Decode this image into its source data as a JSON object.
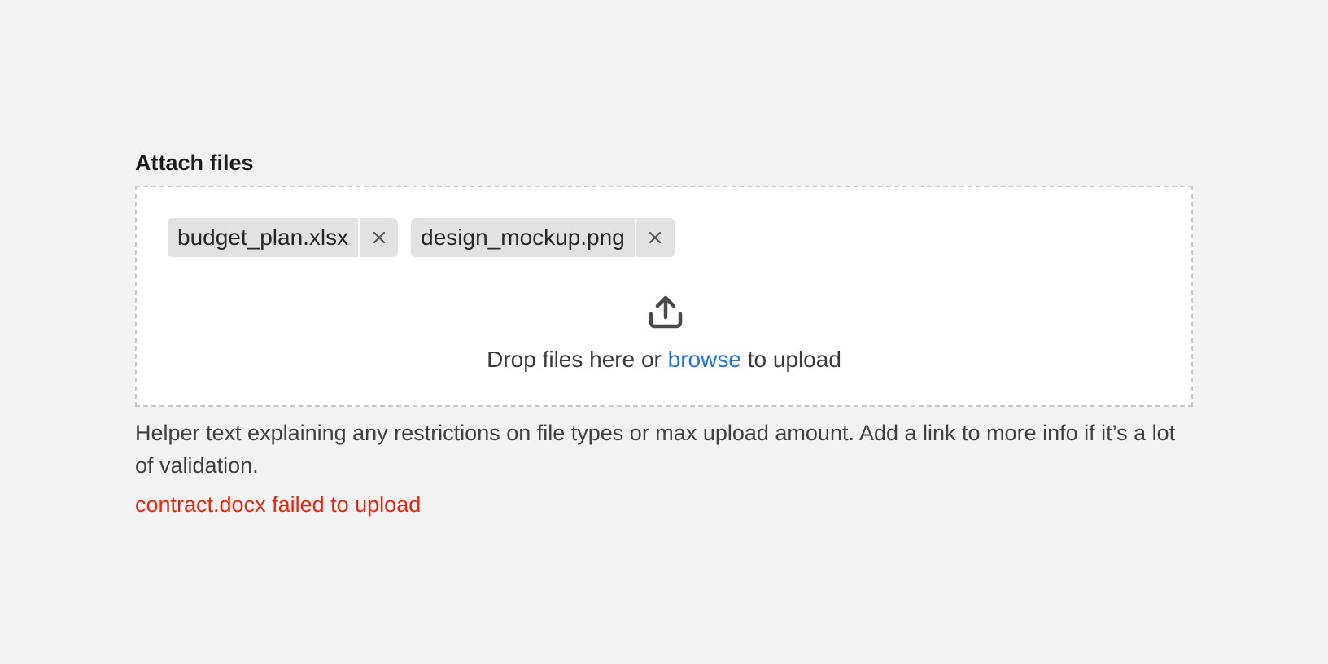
{
  "field": {
    "label": "Attach files"
  },
  "files": [
    {
      "name": "budget_plan.xlsx"
    },
    {
      "name": "design_mockup.png"
    }
  ],
  "dropzone": {
    "icon": "upload-icon",
    "text_before": "Drop files here or ",
    "browse_label": "browse",
    "text_after": " to upload"
  },
  "helper_text": "Helper text explaining any restrictions on file types or max upload amount. Add a link to more info if it’s a lot of validation.",
  "error_text": "contract.docx failed to upload",
  "colors": {
    "link": "#1a73e8",
    "error": "#e2280f",
    "chip_bg": "#e2e2e2"
  }
}
